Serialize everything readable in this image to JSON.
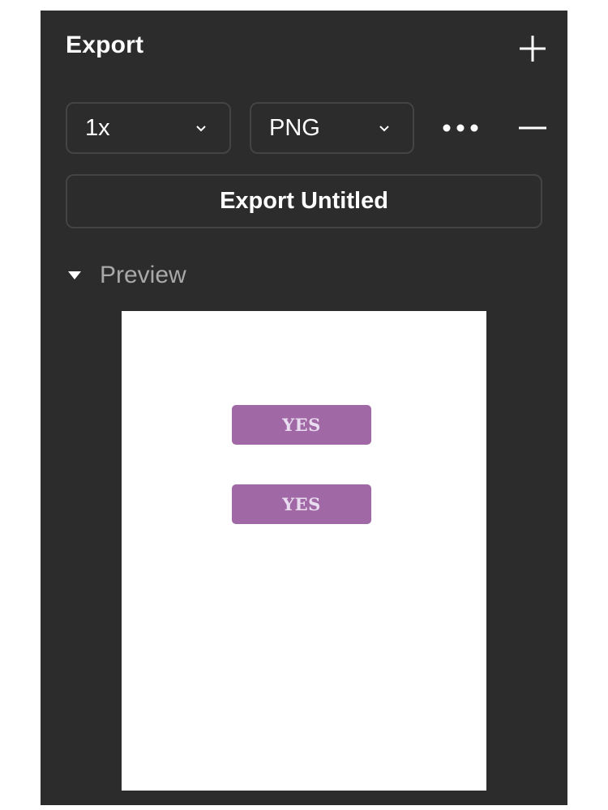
{
  "header": {
    "title": "Export"
  },
  "controls": {
    "scale": {
      "value": "1x"
    },
    "format": {
      "value": "PNG"
    }
  },
  "export_button": {
    "label": "Export Untitled"
  },
  "preview": {
    "label": "Preview",
    "expanded": true,
    "buttons": [
      {
        "label": "YES"
      },
      {
        "label": "YES"
      }
    ]
  },
  "colors": {
    "panel_background": "#2c2c2c",
    "border": "#444444",
    "preview_button": "#a068a5",
    "preview_button_text": "#e9dcf0"
  },
  "icons": [
    "plus-icon",
    "chevron-down-icon",
    "more-horizontal-icon",
    "minus-icon",
    "caret-down-icon"
  ]
}
